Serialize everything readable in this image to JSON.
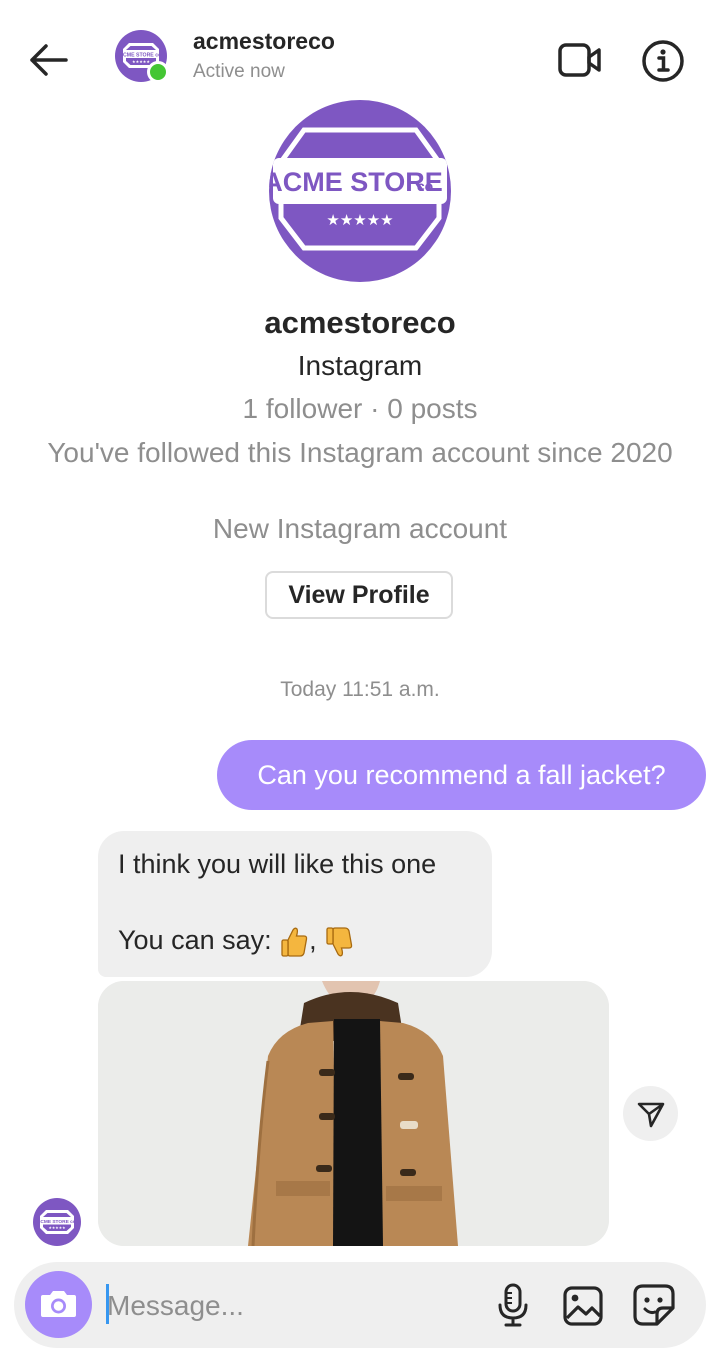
{
  "header": {
    "username": "acmestoreco",
    "status": "Active now",
    "avatar_logo_text": "ACME STORE CO."
  },
  "profile": {
    "username": "acmestoreco",
    "platform": "Instagram",
    "stats": "1 follower · 0 posts",
    "followed_since": "You've followed this Instagram account since 2020",
    "account_note": "New Instagram account",
    "view_profile_label": "View Profile",
    "logo": {
      "main": "ACME STORE",
      "suffix": "co.",
      "stars": "★★★★★"
    }
  },
  "conversation": {
    "timestamp": "Today 11:51 a.m.",
    "messages": [
      {
        "sender": "me",
        "text": "Can you recommend a fall jacket?"
      },
      {
        "sender": "them",
        "line1": "I think you will like this one",
        "line2": "You can say: ",
        "separator": ", "
      },
      {
        "sender": "them",
        "attachment": "photo-of-camel-duffle-coat"
      }
    ]
  },
  "composer": {
    "placeholder": "Message..."
  },
  "colors": {
    "accent": "#a78bfa",
    "brand_purple": "#7e57c2",
    "online": "#44c634",
    "muted_text": "#8e8e8e",
    "bubble_bg": "#efefef"
  },
  "icons": [
    "back-arrow-icon",
    "video-call-icon",
    "info-icon",
    "send-share-icon",
    "camera-icon",
    "microphone-icon",
    "gallery-icon",
    "sticker-icon",
    "thumbs-up-emoji",
    "thumbs-down-emoji"
  ]
}
